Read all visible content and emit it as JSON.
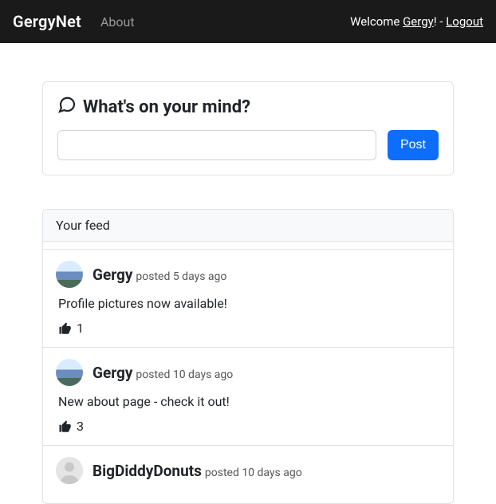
{
  "nav": {
    "brand": "GergyNet",
    "about": "About",
    "welcome_prefix": "Welcome ",
    "username": "Gergy",
    "welcome_suffix": "! - ",
    "logout": "Logout"
  },
  "compose": {
    "heading": "What's on your mind?",
    "input_value": "",
    "post_label": "Post"
  },
  "feed": {
    "header": "Your feed",
    "items": [
      {
        "author": "Gergy",
        "meta": "posted 5 days ago",
        "body": "Profile pictures now available!",
        "likes": "1",
        "avatar_type": "photo"
      },
      {
        "author": "Gergy",
        "meta": "posted 10 days ago",
        "body": "New about page - check it out!",
        "likes": "3",
        "avatar_type": "photo"
      },
      {
        "author": "BigDiddyDonuts",
        "meta": "posted 10 days ago",
        "body": "",
        "likes": "",
        "avatar_type": "placeholder"
      }
    ]
  }
}
